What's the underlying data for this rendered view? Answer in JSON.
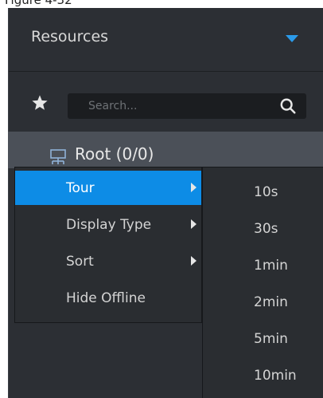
{
  "caption": "Figure 4-32",
  "panel": {
    "title": "Resources"
  },
  "search": {
    "placeholder": "Search..."
  },
  "tree": {
    "root_label": "Root (0/0)"
  },
  "context_menu": {
    "items": [
      {
        "label": "Tour",
        "has_submenu": true,
        "active": true
      },
      {
        "label": "Display Type",
        "has_submenu": true,
        "active": false
      },
      {
        "label": "Sort",
        "has_submenu": true,
        "active": false
      },
      {
        "label": "Hide Offline",
        "has_submenu": false,
        "active": false
      }
    ]
  },
  "tour_submenu": {
    "items": [
      "10s",
      "30s",
      "1min",
      "2min",
      "5min",
      "10min"
    ]
  },
  "colors": {
    "panel_bg": "#2c2f34",
    "accent": "#2b9bea",
    "active_item": "#0d8ce6",
    "selected_row": "#4b5058"
  },
  "icons": {
    "favorites": "star-icon",
    "search": "search-icon",
    "collapse": "caret-down-icon",
    "tree_node": "device-tree-icon",
    "submenu": "chevron-right-icon"
  }
}
